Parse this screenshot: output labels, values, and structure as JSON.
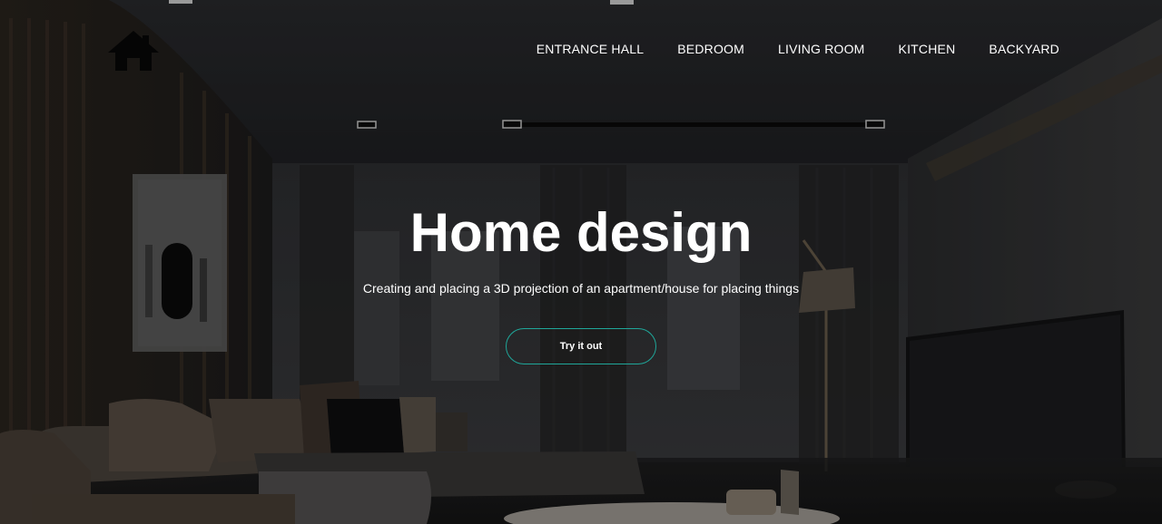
{
  "brand": {
    "logo_icon": "house-icon"
  },
  "nav": {
    "items": [
      {
        "label": "ENTRANCE HALL"
      },
      {
        "label": "BEDROOM"
      },
      {
        "label": "LIVING ROOM"
      },
      {
        "label": "KITCHEN"
      },
      {
        "label": "BACKYARD"
      }
    ]
  },
  "hero": {
    "title": "Home design",
    "subtitle": "Creating and placing a 3D projection of an apartment/house for placing things",
    "cta_label": "Try it out"
  },
  "colors": {
    "accent": "#1fa79a",
    "text": "#ffffff",
    "background": "#1b1b1d"
  }
}
